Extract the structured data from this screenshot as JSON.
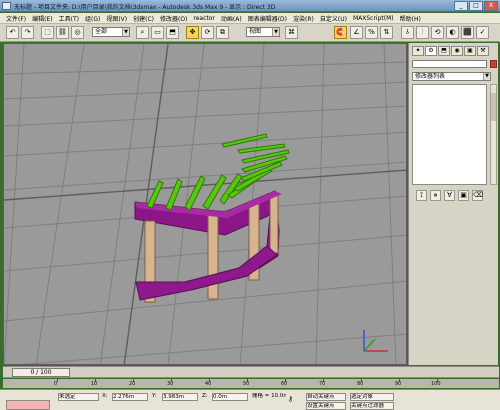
{
  "window": {
    "title": "无标题  - 项目文件夹: D:\\用户目录\\我的文档\\3dsmax    - Autodesk 3ds Max 9    - 显示 : Direct 3D",
    "buttons": [
      "_",
      "□",
      "X"
    ]
  },
  "menu": [
    "文件(F)",
    "编辑(E)",
    "工具(T)",
    "组(G)",
    "视图(V)",
    "创建(C)",
    "修改器(O)",
    "reactor",
    "动画(A)",
    "图表编辑器(D)",
    "渲染(R)",
    "自定义(U)",
    "MAXScript(M)",
    "帮助(H)"
  ],
  "toolbar": {
    "selection_filter": "全部",
    "ref_coord": "视图",
    "left_tools": [
      "↶",
      "↷",
      "⬚",
      "⛓",
      "◎",
      "⌕",
      "▭",
      "⬒",
      "✥",
      "⟳",
      "⧉"
    ],
    "right_tools": [
      "⌘",
      "🧲",
      "∠",
      "%",
      "⇅",
      "⫰",
      "⫶",
      "⟲",
      "◐",
      "⬛",
      "✓"
    ]
  },
  "viewport": {
    "label": ""
  },
  "command_panel": {
    "tabs": [
      "✦",
      "⚙",
      "⬒",
      "◉",
      "▣",
      "⚒"
    ],
    "object_name": "",
    "color": "#d53a36",
    "modifier_list": "修改器列表",
    "buttons": [
      "⟟",
      "⏸",
      "∀",
      "▣",
      "⌫"
    ]
  },
  "timeline": {
    "slider": "0 / 100",
    "ticks": [
      "0",
      "10",
      "20",
      "30",
      "40",
      "50",
      "60",
      "70",
      "80",
      "90",
      "100"
    ]
  },
  "status": {
    "selection": "未选定",
    "x_label": "X:",
    "x_value": "2.276m",
    "y_label": "Y:",
    "y_value": "3.983m",
    "z_label": "Z:",
    "z_value": "0.0m",
    "grid": "栅格 = 10.0m",
    "autokey": "自动关键点",
    "selected_mode": "选定对象",
    "setkey": "设置关键点",
    "keyfilters": "关键点过滤器"
  }
}
